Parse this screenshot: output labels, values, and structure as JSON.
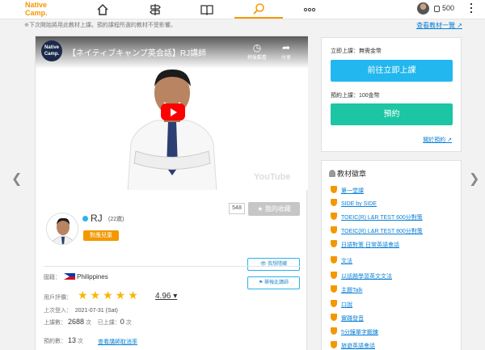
{
  "nav": {
    "logo_line1": "Native",
    "logo_line2": "Camp.",
    "items": [
      "home-icon",
      "signpost-icon",
      "book-icon",
      "search-icon",
      "more-icon"
    ],
    "active": "search-icon",
    "coins": "500"
  },
  "notice": "※下次開始將用此教材上課。預約課程所選的教材不受影響。",
  "see_materials": "查看教材一覽 ↗",
  "video": {
    "channel_logo": "Native Camp.",
    "title": "【ネイティブキャンプ英会話】RJ講師",
    "watch_later": "稍後觀看",
    "share": "分享",
    "watermark": "YouTube"
  },
  "tutor": {
    "fav_count": "548",
    "fav_label": "★ 我的收藏",
    "name": "RJ",
    "age": "(22歲)",
    "kids_badge": "對應兒童",
    "hide_label": "👁 我想隱藏",
    "report_label": "⚑ 舉報此講師"
  },
  "info": {
    "country_label": "國籍：",
    "country": "Philippines",
    "rating_label": "用戶評價：",
    "rating": "4.96",
    "stars": "★★★★★",
    "last_login_label": "上次登入：",
    "last_login": "2021-07-31 (Sat)",
    "lessons_label": "上課數：",
    "lessons": "2688",
    "lessons_unit": "次",
    "attended_label": "已上課：",
    "attended": "0",
    "attended_unit": "次",
    "bookings_label": "預約數：",
    "bookings": "13",
    "bookings_unit": "次",
    "cancel_link": "查看講師取消率"
  },
  "booking": {
    "instant_label": "立即上課：無需金幣",
    "instant_btn": "前往立即上課",
    "instant_color": "#22b7ee",
    "reserve_label": "預約上課：100金幣",
    "reserve_btn": "預約",
    "reserve_color": "#1cc5a3",
    "about_link": "關於預約 ↗"
  },
  "materials": {
    "title": "教材徽章",
    "items": [
      "第一堂課",
      "SIDE by SIDE",
      "TOEIC(R) L&R TEST 600分對策",
      "TOEIC(R) L&R TEST 800分對策",
      "日語對策 日常英語會話",
      "文法",
      "以話題學習英文文法",
      "主題Talk",
      "口說",
      "實踐發音",
      "5分鐘單字鍛鍊",
      "旅遊英語會話"
    ]
  }
}
